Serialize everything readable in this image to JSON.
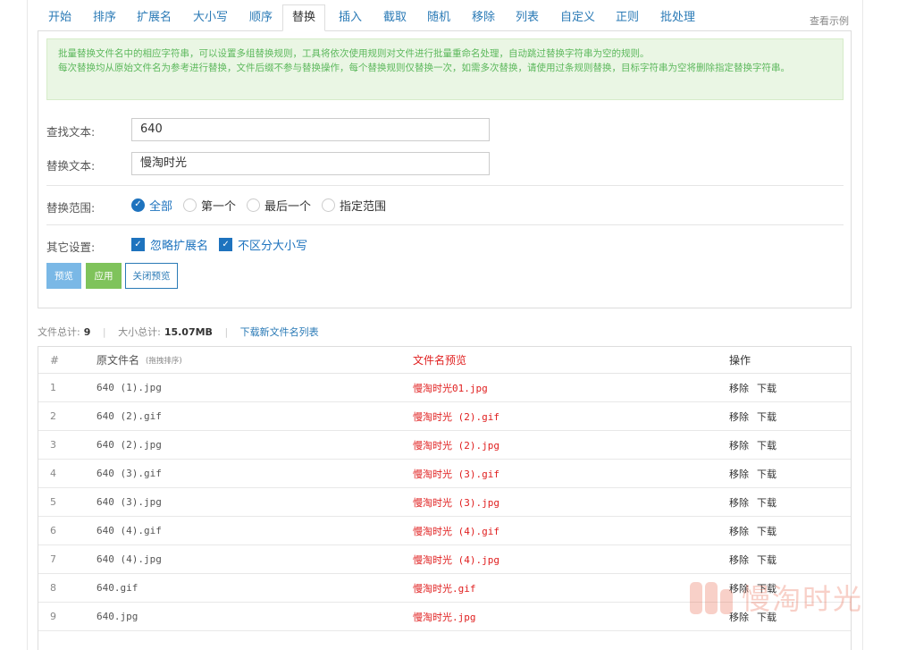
{
  "tabs": [
    {
      "label": "开始"
    },
    {
      "label": "排序"
    },
    {
      "label": "扩展名"
    },
    {
      "label": "大小写"
    },
    {
      "label": "顺序"
    },
    {
      "label": "替换"
    },
    {
      "label": "插入"
    },
    {
      "label": "截取"
    },
    {
      "label": "随机"
    },
    {
      "label": "移除"
    },
    {
      "label": "列表"
    },
    {
      "label": "自定义"
    },
    {
      "label": "正则"
    },
    {
      "label": "批处理"
    }
  ],
  "active_tab": "替换",
  "examples_link": "查看示例",
  "notice": {
    "line1": "批量替换文件名中的相应字符串，可以设置多组替换规则，工具将依次使用规则对文件进行批量重命名处理，自动跳过替换字符串为空的规则。",
    "line2": "每次替换均从原始文件名为参考进行替换，文件后缀不参与替换操作，每个替换规则仅替换一次，如需多次替换，请使用过条规则替换，目标字符串为空将删除指定替换字符串。"
  },
  "form": {
    "find_label": "查找文本:",
    "find_value": "640",
    "replace_label": "替换文本:",
    "replace_value": "慢淘时光",
    "scope_label": "替换范围:",
    "scope_options": [
      {
        "label": "全部",
        "checked": true
      },
      {
        "label": "第一个",
        "checked": false
      },
      {
        "label": "最后一个",
        "checked": false
      },
      {
        "label": "指定范围",
        "checked": false
      }
    ],
    "other_label": "其它设置:",
    "other_options": [
      {
        "label": "忽略扩展名",
        "checked": true
      },
      {
        "label": "不区分大小写",
        "checked": true
      }
    ]
  },
  "buttons": {
    "preview": "预览",
    "apply": "应用",
    "close_preview": "关闭预览"
  },
  "summary": {
    "file_count_label": "文件总计:",
    "file_count": "9",
    "size_label": "大小总计:",
    "size_total": "15.07MB",
    "download_list": "下载新文件名列表"
  },
  "table": {
    "headers": {
      "num": "#",
      "original": "原文件名",
      "sort_hint": "(拖拽排序)",
      "preview": "文件名预览",
      "actions": "操作"
    },
    "action_remove": "移除",
    "action_download": "下载",
    "rows": [
      {
        "num": "1",
        "original": "640 (1).jpg",
        "preview": "慢淘时光01.jpg"
      },
      {
        "num": "2",
        "original": "640 (2).gif",
        "preview": "慢淘时光 (2).gif"
      },
      {
        "num": "3",
        "original": "640 (2).jpg",
        "preview": "慢淘时光 (2).jpg"
      },
      {
        "num": "4",
        "original": "640 (3).gif",
        "preview": "慢淘时光 (3).gif"
      },
      {
        "num": "5",
        "original": "640 (3).jpg",
        "preview": "慢淘时光 (3).jpg"
      },
      {
        "num": "6",
        "original": "640 (4).gif",
        "preview": "慢淘时光 (4).gif"
      },
      {
        "num": "7",
        "original": "640 (4).jpg",
        "preview": "慢淘时光 (4).jpg"
      },
      {
        "num": "8",
        "original": "640.gif",
        "preview": "慢淘时光.gif"
      },
      {
        "num": "9",
        "original": "640.jpg",
        "preview": "慢淘时光.jpg"
      }
    ]
  },
  "watermark": "慢淘时光",
  "colors": {
    "link": "#2a7ab6",
    "accent": "#1e73be",
    "preview_text": "#e02020",
    "notice_bg": "#eaf6e4",
    "notice_text": "#5cb85c",
    "btn_preview": "#7ab8e6",
    "btn_apply": "#7fc35b"
  }
}
